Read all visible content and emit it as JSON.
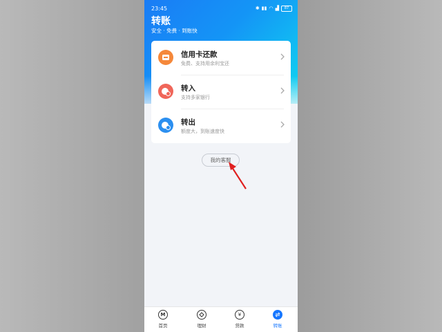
{
  "status": {
    "time": "23:45",
    "battery": "87"
  },
  "header": {
    "title": "转账",
    "subtitle": "安全 · 免费 · 到账快"
  },
  "items": [
    {
      "name": "信用卡还款",
      "desc": "免费、支持用余利宝还",
      "color": "#f5883a"
    },
    {
      "name": "转入",
      "desc": "支持多家银行",
      "color": "#f0665a"
    },
    {
      "name": "转出",
      "desc": "额度大，到账速度快",
      "color": "#2b8ff0"
    }
  ],
  "service_button": "我的客服",
  "tabs": [
    {
      "label": "首页",
      "icon": "M"
    },
    {
      "label": "理财",
      "icon": ""
    },
    {
      "label": "贷款",
      "icon": "¥"
    },
    {
      "label": "转账",
      "icon": ""
    }
  ],
  "colors": {
    "accent": "#1677ff",
    "arrow": "#e02020"
  }
}
